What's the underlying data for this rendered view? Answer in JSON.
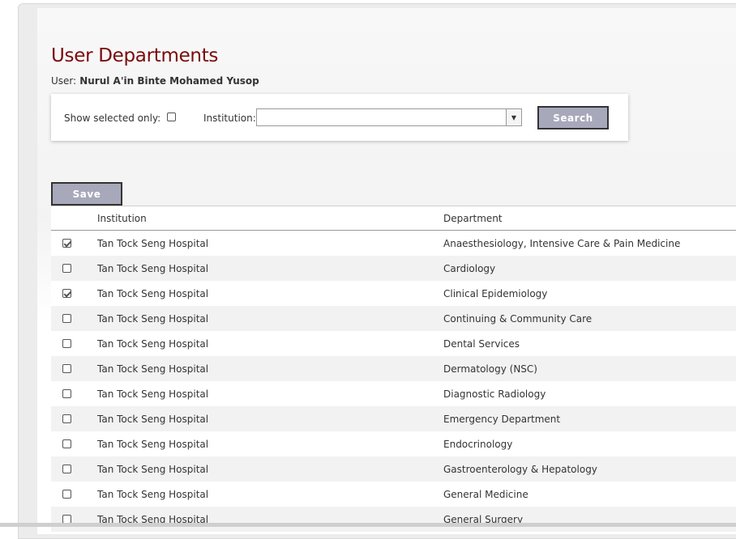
{
  "page": {
    "title": "User Departments",
    "user_label": "User:",
    "user_name": "Nurul A'in Binte Mohamed Yusop"
  },
  "filter": {
    "show_selected_label": "Show selected only:",
    "show_selected_checked": false,
    "institution_label": "Institution:",
    "institution_value": "",
    "search_label": "Search"
  },
  "toolbar": {
    "save_label": "Save"
  },
  "table": {
    "columns": [
      "",
      "Institution",
      "Department"
    ],
    "rows": [
      {
        "checked": true,
        "institution": "Tan Tock Seng Hospital",
        "department": "Anaesthesiology, Intensive Care & Pain Medicine"
      },
      {
        "checked": false,
        "institution": "Tan Tock Seng Hospital",
        "department": "Cardiology"
      },
      {
        "checked": true,
        "institution": "Tan Tock Seng Hospital",
        "department": "Clinical Epidemiology"
      },
      {
        "checked": false,
        "institution": "Tan Tock Seng Hospital",
        "department": "Continuing & Community Care"
      },
      {
        "checked": false,
        "institution": "Tan Tock Seng Hospital",
        "department": "Dental Services"
      },
      {
        "checked": false,
        "institution": "Tan Tock Seng Hospital",
        "department": "Dermatology (NSC)"
      },
      {
        "checked": false,
        "institution": "Tan Tock Seng Hospital",
        "department": "Diagnostic Radiology"
      },
      {
        "checked": false,
        "institution": "Tan Tock Seng Hospital",
        "department": "Emergency Department"
      },
      {
        "checked": false,
        "institution": "Tan Tock Seng Hospital",
        "department": "Endocrinology"
      },
      {
        "checked": false,
        "institution": "Tan Tock Seng Hospital",
        "department": "Gastroenterology & Hepatology"
      },
      {
        "checked": false,
        "institution": "Tan Tock Seng Hospital",
        "department": "General Medicine"
      },
      {
        "checked": false,
        "institution": "Tan Tock Seng Hospital",
        "department": "General Surgery"
      }
    ]
  },
  "colors": {
    "title": "#7a0a0a",
    "button_bg": "#a8a8bb",
    "row_alt": "#f2f2f2"
  }
}
